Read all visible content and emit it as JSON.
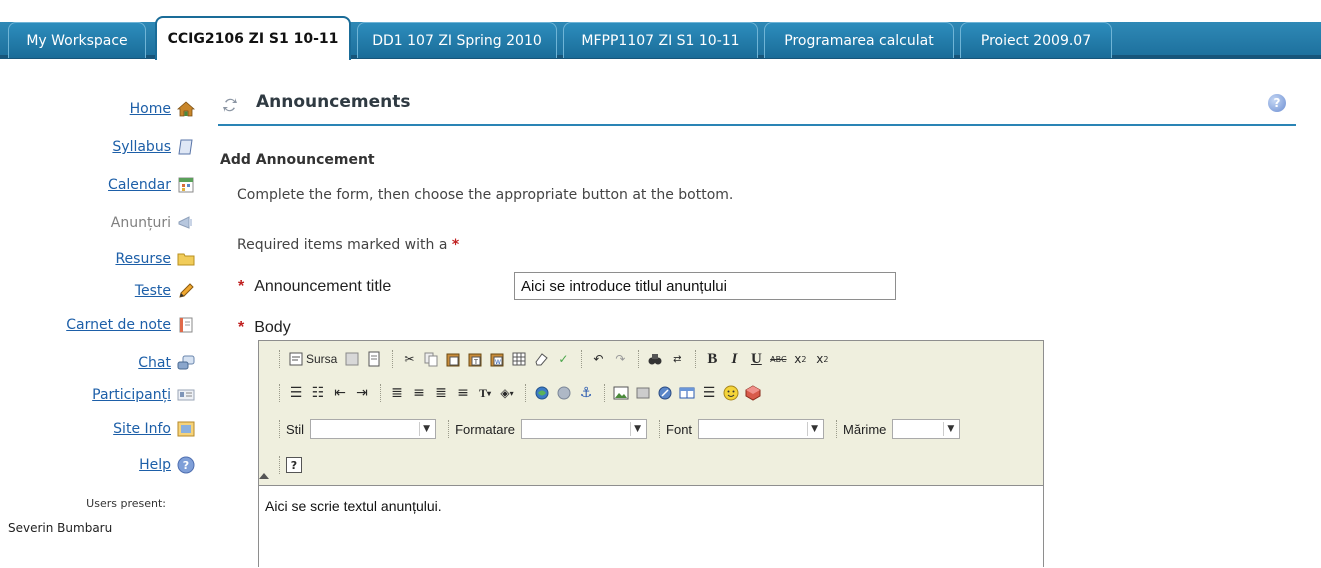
{
  "tabs": [
    {
      "label": "My Workspace",
      "active": false
    },
    {
      "label": "CCIG2106 ZI S1 10-11",
      "active": true
    },
    {
      "label": "DD1 107 ZI Spring 2010",
      "active": false
    },
    {
      "label": "MFPP1107 ZI S1 10-11",
      "active": false
    },
    {
      "label": "Programarea calculat",
      "active": false
    },
    {
      "label": "Proiect 2009.07",
      "active": false
    }
  ],
  "toolmenu": {
    "items": [
      {
        "label": "Home",
        "icon": "home-icon",
        "current": false
      },
      {
        "label": "Syllabus",
        "icon": "syllabus-icon",
        "current": false
      },
      {
        "label": "Calendar",
        "icon": "calendar-icon",
        "current": false
      },
      {
        "label": "Anunțuri",
        "icon": "announcements-icon",
        "current": true
      },
      {
        "label": "Resurse",
        "icon": "folder-icon",
        "current": false
      },
      {
        "label": "Teste",
        "icon": "pencil-icon",
        "current": false
      },
      {
        "label": "Carnet de note",
        "icon": "gradebook-icon",
        "current": false
      },
      {
        "label": "Chat",
        "icon": "chat-icon",
        "current": false
      },
      {
        "label": "Participanți",
        "icon": "roster-icon",
        "current": false
      },
      {
        "label": "Site Info",
        "icon": "site-info-icon",
        "current": false
      },
      {
        "label": "Help",
        "icon": "help-icon",
        "current": false
      }
    ],
    "users_present_label": "Users present:",
    "users": [
      "Severin Bumbaru"
    ]
  },
  "page": {
    "title": "Announcements",
    "subtitle": "Add Announcement",
    "instructions": "Complete the form, then choose the appropriate button at the bottom.",
    "required_note": "Required items marked with a",
    "required_star": "*"
  },
  "form": {
    "title_label": "Announcement title",
    "title_value": "Aici se introduce titlul anunțului",
    "body_label": "Body",
    "body_value": "Aici se scrie textul anunțului."
  },
  "editor": {
    "source_label": "Sursa",
    "style_label": "Stil",
    "format_label": "Formatare",
    "font_label": "Font",
    "size_label": "Mărime",
    "help_glyph": "?"
  },
  "colors": {
    "tab_blue": "#1c6f9c",
    "link_blue": "#1d5fa8",
    "required_red": "#c02020",
    "editor_bg": "#efefde"
  }
}
